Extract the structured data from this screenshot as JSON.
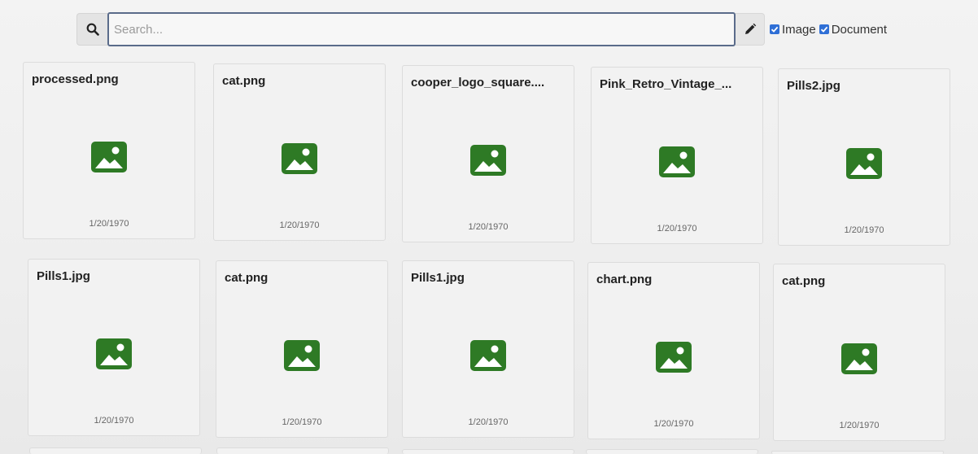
{
  "search": {
    "placeholder": "Search..."
  },
  "filters": [
    {
      "label": "Image",
      "checked": true
    },
    {
      "label": "Document",
      "checked": true
    }
  ],
  "icons": {
    "search": "search-icon",
    "edit": "pencil-icon",
    "file": "image-icon",
    "checkbox": "checkbox-checked-icon"
  },
  "colors": {
    "image_icon": "#2e7a25",
    "checkbox": "#2f6fd6",
    "search_border": "#5a6b8a"
  },
  "files": [
    {
      "name": "processed.png",
      "date": "1/20/1970"
    },
    {
      "name": "cat.png",
      "date": "1/20/1970"
    },
    {
      "name": "cooper_logo_square....",
      "date": "1/20/1970"
    },
    {
      "name": "Pink_Retro_Vintage_...",
      "date": "1/20/1970"
    },
    {
      "name": "Pills2.jpg",
      "date": "1/20/1970"
    },
    {
      "name": "Pills1.jpg",
      "date": "1/20/1970"
    },
    {
      "name": "cat.png",
      "date": "1/20/1970"
    },
    {
      "name": "Pills1.jpg",
      "date": "1/20/1970"
    },
    {
      "name": "chart.png",
      "date": "1/20/1970"
    },
    {
      "name": "cat.png",
      "date": "1/20/1970"
    }
  ]
}
